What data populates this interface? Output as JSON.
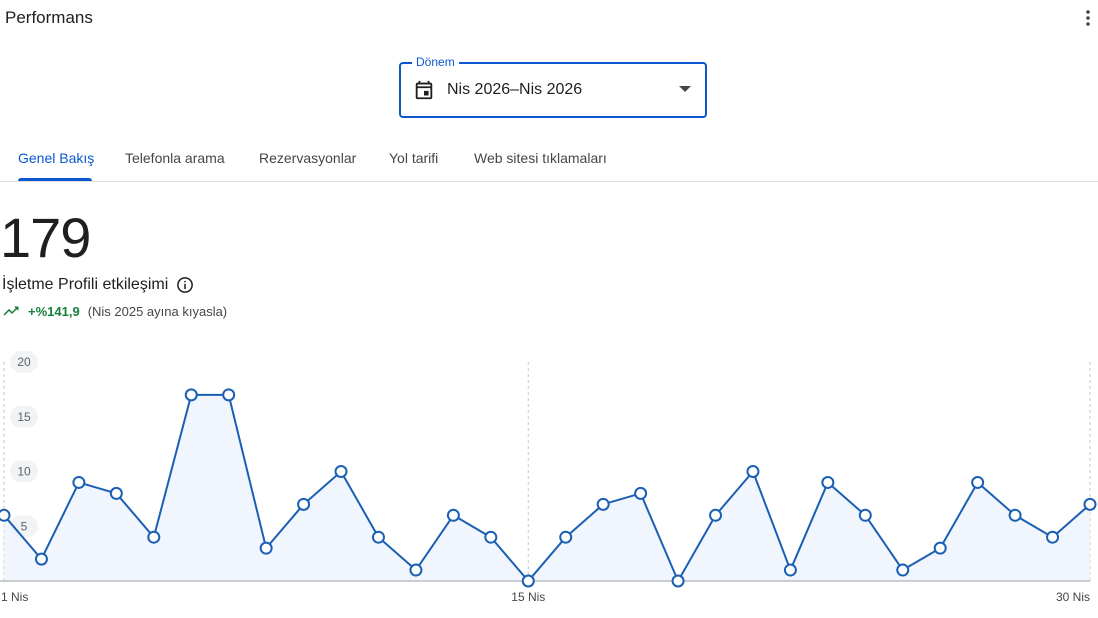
{
  "header": {
    "title": "Performans",
    "more_icon": "more-vert-icon"
  },
  "period": {
    "label": "Dönem",
    "value": "Nis 2026–Nis 2026",
    "icon": "calendar-icon"
  },
  "tabs": [
    {
      "label": "Genel Bakış",
      "active": true
    },
    {
      "label": "Telefonla arama",
      "active": false
    },
    {
      "label": "Rezervasyonlar",
      "active": false
    },
    {
      "label": "Yol tarifi",
      "active": false
    },
    {
      "label": "Web sitesi tıklamaları",
      "active": false
    }
  ],
  "summary": {
    "total": "179",
    "metric_label": "İşletme Profili etkileşimi",
    "change": "+%141,9",
    "comparison": "(Nis 2025 ayına kıyasla)"
  },
  "colors": {
    "accent": "#0b57d0",
    "line": "#1a5fb4",
    "positive": "#188038"
  },
  "chart_data": {
    "type": "area",
    "x": [
      1,
      2,
      3,
      4,
      5,
      6,
      7,
      8,
      9,
      10,
      11,
      12,
      13,
      14,
      15,
      16,
      17,
      18,
      19,
      20,
      21,
      22,
      23,
      24,
      25,
      26,
      27,
      28,
      29,
      30
    ],
    "x_tick_labels": [
      {
        "x": 1,
        "label": "1 Nis"
      },
      {
        "x": 15,
        "label": "15 Nis"
      },
      {
        "x": 30,
        "label": "30 Nis"
      }
    ],
    "y_ticks": [
      "20",
      "15",
      "10",
      "5"
    ],
    "ylim": [
      0,
      20
    ],
    "series": [
      {
        "values": [
          6,
          2,
          9,
          8,
          4,
          17,
          17,
          3,
          7,
          10,
          4,
          1,
          6,
          4,
          0,
          4,
          7,
          8,
          0,
          6,
          10,
          1,
          9,
          6,
          1,
          3,
          9,
          6,
          4,
          7
        ]
      }
    ],
    "grid": true
  }
}
